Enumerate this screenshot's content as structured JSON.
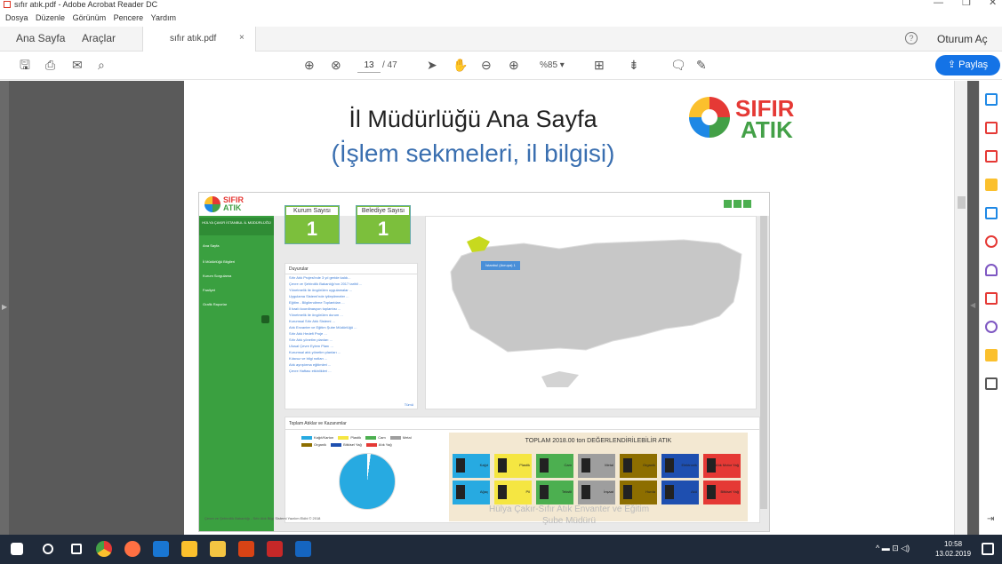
{
  "window": {
    "title": "sıfır atık.pdf - Adobe Acrobat Reader DC",
    "min": "—",
    "max": "❐",
    "close": "✕"
  },
  "menu": [
    "Dosya",
    "Düzenle",
    "Görünüm",
    "Pencere",
    "Yardım"
  ],
  "tabs": {
    "home": "Ana Sayfa",
    "tools": "Araçlar",
    "doc": "sıfır atık.pdf",
    "doc_close": "×"
  },
  "account": {
    "help": "?",
    "signin": "Oturum Aç"
  },
  "toolbar": {
    "page_current": "13",
    "page_total": "/ 47",
    "zoom": "%85 ▾",
    "share": "Paylaş"
  },
  "slide": {
    "title": "İl Müdürlüğü Ana Sayfa",
    "subtitle": "(İşlem sekmeleri, il bilgisi)",
    "logo_line1": "SIFIR",
    "logo_line2": "ATIK",
    "watermark1": "Hülya Çakır-Sıfır Atık Envanter ve Eğitim",
    "watermark2": "Şube Müdürü"
  },
  "app": {
    "logo1": "SIFIR",
    "logo2": "ATIK",
    "sidebar_head": "HÜLYA ÇAKIR\nİSTANBUL İL MÜDÜRLÜĞÜ",
    "sidebar_items": [
      "Ana Sayfa",
      "İl Müdürlüğü Bilgileri",
      "Kurum Sorgulama",
      "Faaliyet",
      "Grafik Raporlar"
    ],
    "cards": [
      {
        "label": "Kurum Sayısı",
        "value": "1"
      },
      {
        "label": "Belediye Sayısı",
        "value": "1"
      }
    ],
    "announcements_title": "Duyurular",
    "announcements": [
      "Sıfır Atık Projesi'nde 3 yıl geride kaldı...",
      "Çevre ve Şehircilik Bakanlığı'nın 2017 tarihli ...",
      "Yönetmelik ile öngörülen uygulamalar ...",
      "Uygulama Sistemi'nde iyileştirmeler ...",
      "Eğitim - Bilgilendirme Toplantıları ...",
      "İl bazlı koordinasyon toplantısı ...",
      "Yönetmelik ile öngörülen durum ...",
      "Kurumsal Sıfır Atık Sistemi ...",
      "Atık Envanter ve Eğitim Şube Müdürlüğü ...",
      "Sıfır Atık Hedefi Proje ...",
      "Sıfır Atık yönetim planları ...",
      "Ulusal Çevre Eylem Planı ...",
      "Kurumsal atık yönetim planları ...",
      "Kılavuz ve bilgi notları ...",
      "Atık ayrıştırma eğitimleri ...",
      "Çevre Haftası etkinlikleri ..."
    ],
    "announcements_more": "Tümü",
    "map_label": "İstanbul (Avrupa) 1",
    "waste_title": "Toplam Atıklar ve Kazanımlar",
    "legend": [
      "Kağıt/Karton",
      "Plastik",
      "Cam",
      "Metal",
      "Organik",
      "Bitkisel Yağ",
      "Atık Yağ"
    ],
    "grid_title": "TOPLAM 2018.00 ton DEĞERLENDİRİLEBİLİR ATIK",
    "grid_cells": [
      "Kağıt",
      "Plastik",
      "Cam",
      "Metal",
      "Organik",
      "Elektronik",
      "Atık Motor Yağ",
      "Ağaç",
      "Pil",
      "Tekstil",
      "İnşaat",
      "Hurda",
      "Akü",
      "Bitkisel Yağ"
    ],
    "footer": "Çevre ve Şehircilik Bakanlığı - Sıfır Atık Bilgi Sistemi Yazılım Ekibi © 2018"
  },
  "clock": {
    "time": "10:58",
    "date": "13.02.2019"
  }
}
